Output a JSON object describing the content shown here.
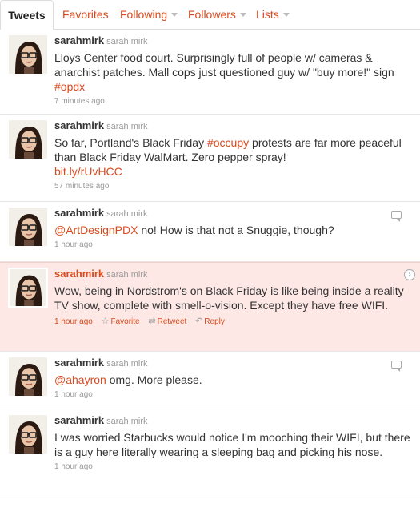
{
  "tabs": [
    {
      "label": "Tweets",
      "active": true
    },
    {
      "label": "Favorites",
      "active": false
    },
    {
      "label": "Following",
      "active": false,
      "dropdown": true
    },
    {
      "label": "Followers",
      "active": false,
      "dropdown": true
    },
    {
      "label": "Lists",
      "active": false,
      "dropdown": true
    }
  ],
  "colors": {
    "link": "#d94a1e",
    "highlight_bg": "#fde8e5",
    "text": "#333333",
    "meta": "#999999"
  },
  "tweets": [
    {
      "username": "sarahmirk",
      "fullname": "sarah mirk",
      "text_parts": [
        "Lloys Center food court. Surprisingly full of people w/ cameras & anarchist patches. Mall cops just questioned guy w/ \"buy more!\" sign ",
        "#opdx",
        ""
      ],
      "time": "7 minutes ago"
    },
    {
      "username": "sarahmirk",
      "fullname": "sarah mirk",
      "text_parts": [
        "So far, Portland's Black Friday ",
        "#occupy",
        " protests are far more peaceful than Black Friday WalMart. Zero pepper spray!"
      ],
      "link": "bit.ly/rUvHCC",
      "time": "57 minutes ago"
    },
    {
      "username": "sarahmirk",
      "fullname": "sarah mirk",
      "text_parts": [
        "",
        "@ArtDesignPDX",
        " no! How is that not a Snuggie, though?"
      ],
      "time": "1 hour ago"
    },
    {
      "username": "sarahmirk",
      "fullname": "sarah mirk",
      "text_parts": [
        "Wow, being in Nordstrom's on Black Friday is like being inside a reality TV show, complete with smell-o-vision. Except they have free WIFI.",
        "",
        ""
      ],
      "time": "1 hour ago",
      "actions": {
        "favorite": "Favorite",
        "retweet": "Retweet",
        "reply": "Reply"
      }
    },
    {
      "username": "sarahmirk",
      "fullname": "sarah mirk",
      "text_parts": [
        "",
        "@ahayron",
        " omg. More please."
      ],
      "time": "1 hour ago"
    },
    {
      "username": "sarahmirk",
      "fullname": "sarah mirk",
      "text_parts": [
        "I was worried Starbucks would notice I'm mooching their WIFI, but there is a guy here literally wearing a sleeping bag and picking his nose.",
        "",
        ""
      ],
      "time": "1 hour ago"
    }
  ]
}
